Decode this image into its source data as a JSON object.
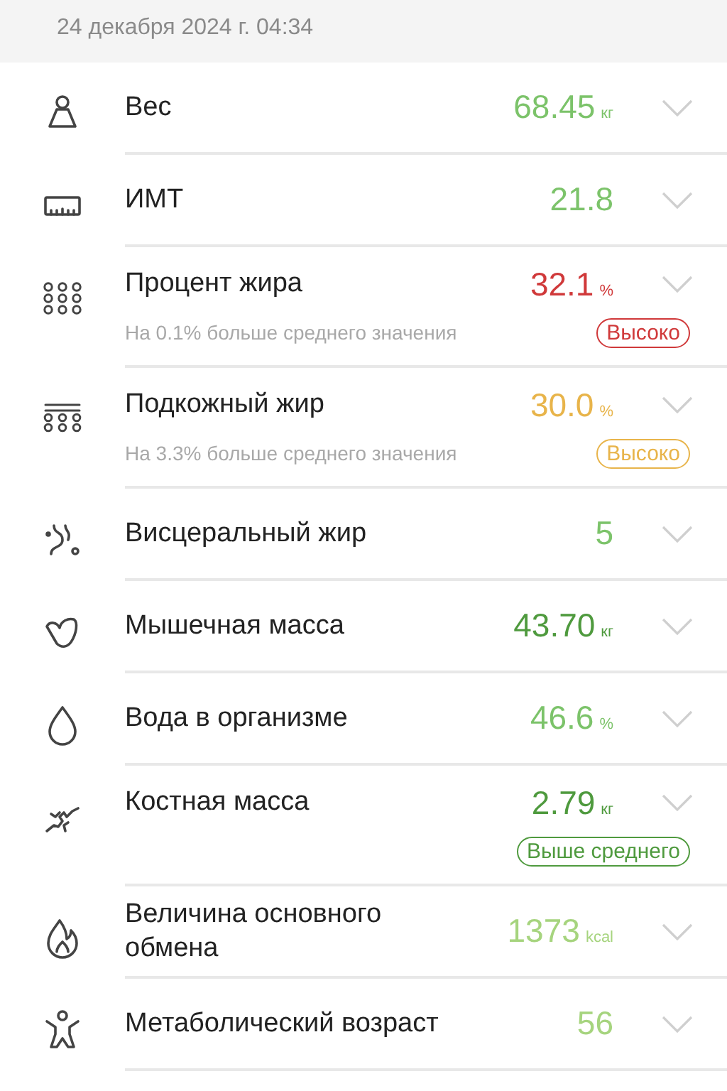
{
  "header": {
    "timestamp": "24 декабря 2024 г. 04:34"
  },
  "metrics": [
    {
      "label": "Вес",
      "value": "68.45",
      "unit": "кг",
      "color": "#7cc36a"
    },
    {
      "label": "ИМТ",
      "value": "21.8",
      "color": "#7cc36a"
    },
    {
      "label": "Процент жира",
      "value": "32.1",
      "unit": "%",
      "color": "#d0393a",
      "note": "На 0.1% больше среднего значения",
      "badge": "Высоко"
    },
    {
      "label": "Подкожный жир",
      "value": "30.0",
      "unit": "%",
      "color": "#e8b44a",
      "note": "На 3.3% больше среднего значения",
      "badge": "Высоко"
    },
    {
      "label": "Висцеральный жир",
      "value": "5",
      "color": "#7cc36a"
    },
    {
      "label": "Мышечная масса",
      "value": "43.70",
      "unit": "кг",
      "color": "#4f9a3e"
    },
    {
      "label": "Вода в организме",
      "value": "46.6",
      "unit": "%",
      "color": "#7cc36a"
    },
    {
      "label": "Костная масса",
      "value": "2.79",
      "unit": "кг",
      "color": "#4f9a3e",
      "badge": "Выше среднего"
    },
    {
      "label": "Величина основного обмена",
      "value": "1373",
      "unit": "kcal",
      "color": "#a6d47e"
    },
    {
      "label": "Метаболический возраст",
      "value": "56",
      "color": "#a6d47e"
    }
  ]
}
